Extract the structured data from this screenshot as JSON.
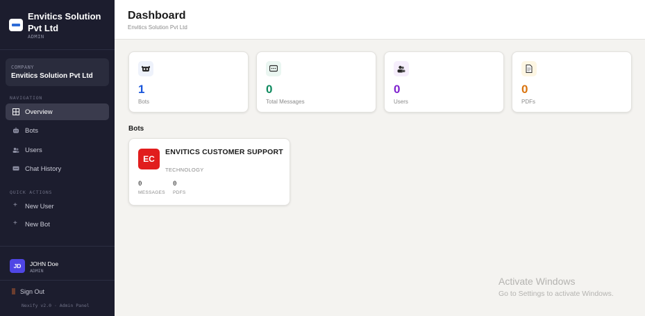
{
  "brand": {
    "name": "Envitics Solution Pvt Ltd",
    "role": "ADMIN"
  },
  "company": {
    "label": "COMPANY",
    "name": "Envitics Solution Pvt Ltd"
  },
  "nav": {
    "section": "NAVIGATION",
    "items": [
      {
        "label": "Overview",
        "icon": "grid-icon",
        "active": true
      },
      {
        "label": "Bots",
        "icon": "bot-icon"
      },
      {
        "label": "Users",
        "icon": "users-icon"
      },
      {
        "label": "Chat History",
        "icon": "chat-icon"
      }
    ]
  },
  "quick_actions": {
    "section": "QUICK ACTIONS",
    "items": [
      {
        "label": "New User",
        "icon": "plus-icon"
      },
      {
        "label": "New Bot",
        "icon": "plus-icon"
      }
    ]
  },
  "user": {
    "initials": "JD",
    "name": "JOHN Doe",
    "role": "ADMIN"
  },
  "sign_out": "Sign Out",
  "footer": "Nexify v2.0 · Admin Panel",
  "header": {
    "title": "Dashboard",
    "subtitle": "Envitics Solution Pvt Ltd"
  },
  "stats": [
    {
      "value": "1",
      "label": "Bots",
      "icon": "bot-icon",
      "color": "#1a56db",
      "bg": "#eef2fb"
    },
    {
      "value": "0",
      "label": "Total Messages",
      "icon": "chat-icon",
      "color": "#0f8a5f",
      "bg": "#eaf6f1"
    },
    {
      "value": "0",
      "label": "Users",
      "icon": "users-icon",
      "color": "#7e22ce",
      "bg": "#f6eefc"
    },
    {
      "value": "0",
      "label": "PDFs",
      "icon": "document-icon",
      "color": "#d9730d",
      "bg": "#fdf6e3"
    }
  ],
  "bots_section": {
    "title": "Bots"
  },
  "bot_card": {
    "initials": "EC",
    "name": "ENVITICS CUSTOMER SUPPORT",
    "category": "TECHNOLOGY",
    "messages_value": "0",
    "messages_label": "MESSAGES",
    "pdfs_value": "0",
    "pdfs_label": "PDFS",
    "badge_color": "#e11d1d"
  },
  "watermark": {
    "title": "Activate Windows",
    "subtitle": "Go to Settings to activate Windows."
  }
}
